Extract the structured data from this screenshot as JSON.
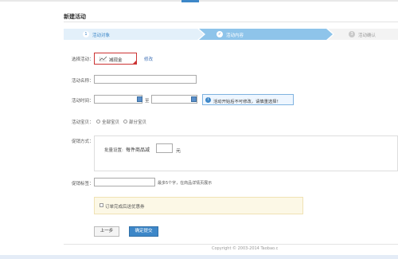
{
  "page": {
    "title": "新建活动"
  },
  "steps": [
    {
      "num": "1",
      "label": "活动对象"
    },
    {
      "num": "✓",
      "label": "活动内容"
    },
    {
      "num": "3",
      "label": "活动确认"
    }
  ],
  "form": {
    "select_activity_label": "选择活动：",
    "activity_name_value": "减现金",
    "modify_link": "修改",
    "activity_name_label": "活动名称：",
    "activity_time_label": "活动时间：",
    "time_separator": "至",
    "time_tip": "活动开始后不可修改，请慎重选择！",
    "activity_items_label": "活动宝贝：",
    "option_all": "全部宝贝",
    "option_partial": "部分宝贝",
    "promo_method_label": "促销方式：",
    "batch_setting_label": "批量设置:",
    "per_item_label": "每件商品减",
    "unit": "元",
    "promo_tag_label": "促销标签：",
    "promo_tag_hint": "最多5个字，在商品详情页展示",
    "order_checkbox_label": "订单完成后送优惠券",
    "prev_button": "上一步",
    "confirm_button": "确定提交"
  },
  "footer": {
    "copyright": "Copyright © 2003-2014 Taobao.c"
  },
  "colors": {
    "accent": "#3d87c8",
    "alert": "#cc3333",
    "notice_bg": "#fcf8e6"
  }
}
